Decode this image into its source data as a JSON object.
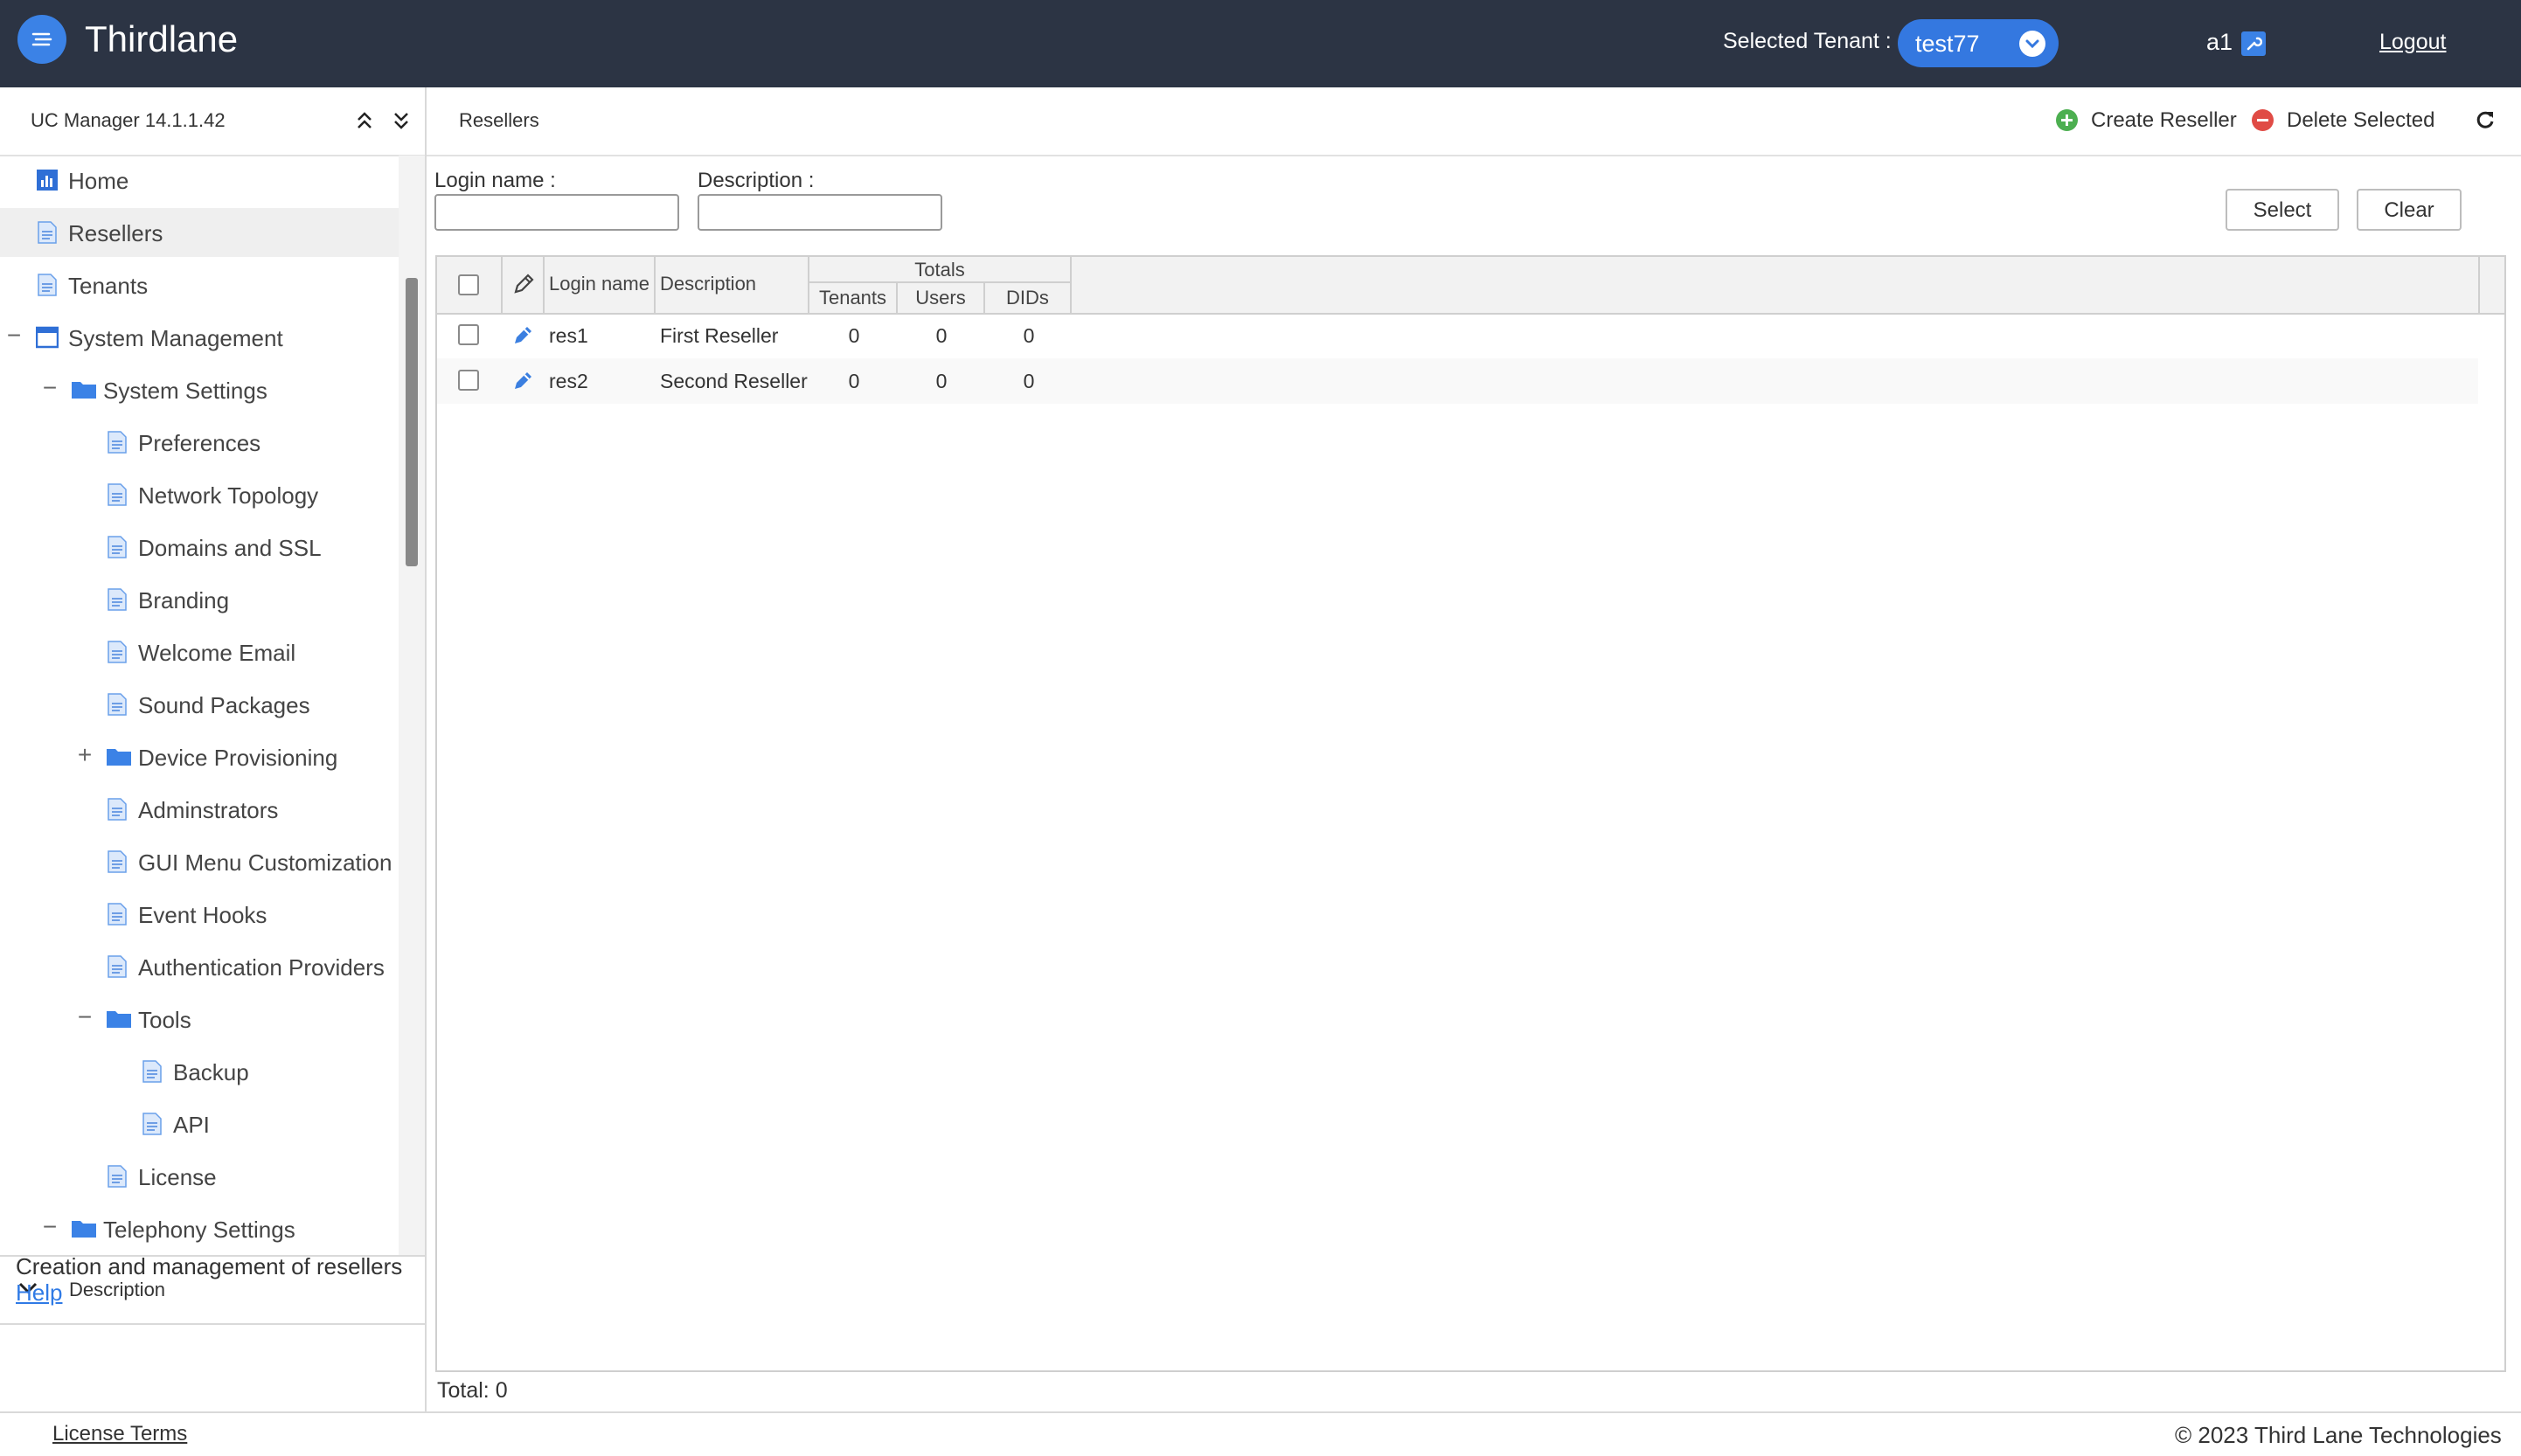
{
  "app": {
    "title": "Thirdlane"
  },
  "topbar": {
    "tenant_label": "Selected Tenant :",
    "tenant_value": "test77",
    "user_name": "a1",
    "logout_label": "Logout"
  },
  "left_panel": {
    "version": "UC Manager 14.1.1.42",
    "nav": {
      "home": "Home",
      "resellers": "Resellers",
      "tenants": "Tenants",
      "system_management": "System Management",
      "system_settings": "System Settings",
      "preferences": "Preferences",
      "network_topology": "Network Topology",
      "domains_ssl": "Domains and SSL",
      "branding": "Branding",
      "welcome_email": "Welcome Email",
      "sound_packages": "Sound Packages",
      "device_provisioning": "Device Provisioning",
      "administrators": "Adminstrators",
      "gui_menu": "GUI Menu Customization",
      "event_hooks": "Event Hooks",
      "auth_providers": "Authentication Providers",
      "tools": "Tools",
      "backup": "Backup",
      "api": "API",
      "license": "License",
      "telephony_settings": "Telephony Settings"
    },
    "description_title": "Description",
    "description_text": "Creation and management of resellers",
    "help_label": "Help"
  },
  "main": {
    "breadcrumb": "Resellers",
    "create_label": "Create Reseller",
    "delete_label": "Delete Selected",
    "filters": {
      "login_label": "Login name :",
      "login_value": "",
      "description_label": "Description :",
      "description_value": ""
    },
    "select_label": "Select",
    "clear_label": "Clear",
    "table": {
      "columns": {
        "login": "Login name",
        "description": "Description",
        "totals": "Totals",
        "tenants": "Tenants",
        "users": "Users",
        "dids": "DIDs"
      },
      "rows": [
        {
          "login": "res1",
          "description": "First Reseller",
          "tenants": "0",
          "users": "0",
          "dids": "0"
        },
        {
          "login": "res2",
          "description": "Second Reseller",
          "tenants": "0",
          "users": "0",
          "dids": "0"
        }
      ]
    },
    "total_text": "Total: 0"
  },
  "footer": {
    "license_terms": "License Terms",
    "copyright": "© 2023 Third Lane Technologies"
  },
  "colors": {
    "topbar": "#2c3444",
    "accent": "#3478e0",
    "create": "#4caf50",
    "delete": "#e04b45"
  }
}
